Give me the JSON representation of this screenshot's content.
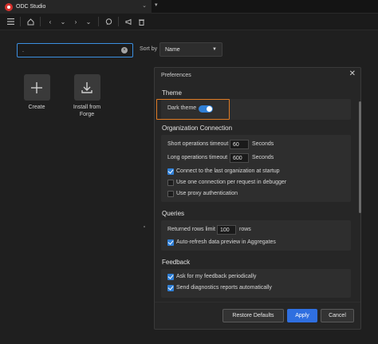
{
  "app": {
    "title": "ODC Studio"
  },
  "toolbar": {
    "icons": [
      "menu-icon",
      "home-icon",
      "back-icon",
      "forward-icon",
      "chat-icon",
      "announcement-icon",
      "trash-icon"
    ]
  },
  "search": {
    "value": ".",
    "clear_icon": "clear-icon"
  },
  "sort": {
    "label": "Sort by",
    "selected": "Name"
  },
  "tiles": [
    {
      "label": "Create",
      "icon": "plus-icon"
    },
    {
      "label_line1": "Install from",
      "label_line2": "Forge",
      "icon": "download-icon"
    }
  ],
  "preferences": {
    "title": "Preferences",
    "theme": {
      "heading": "Theme",
      "dark_theme_label": "Dark theme",
      "dark_theme_on": true
    },
    "org_connection": {
      "heading": "Organization Connection",
      "short_timeout_label": "Short operations timeout",
      "short_timeout_value": "60",
      "short_timeout_unit": "Seconds",
      "long_timeout_label": "Long operations timeout",
      "long_timeout_value": "600",
      "long_timeout_unit": "Seconds",
      "options": [
        {
          "label": "Connect to the last organization at startup",
          "checked": true
        },
        {
          "label": "Use one connection per request in debugger",
          "checked": false
        },
        {
          "label": "Use proxy authentication",
          "checked": false
        }
      ]
    },
    "queries": {
      "heading": "Queries",
      "rows_limit_label": "Returned rows limit",
      "rows_limit_value": "100",
      "rows_limit_unit": "rows",
      "auto_refresh_label": "Auto-refresh data preview in Aggregates",
      "auto_refresh_checked": true
    },
    "feedback": {
      "heading": "Feedback",
      "options": [
        {
          "label": "Ask for my feedback periodically",
          "checked": true
        },
        {
          "label": "Send diagnostics reports automatically",
          "checked": true
        }
      ]
    },
    "buttons": {
      "restore": "Restore Defaults",
      "apply": "Apply",
      "cancel": "Cancel"
    }
  },
  "colors": {
    "accent": "#2f6fe0",
    "highlight": "#e07b24",
    "brand": "#d5312c"
  }
}
